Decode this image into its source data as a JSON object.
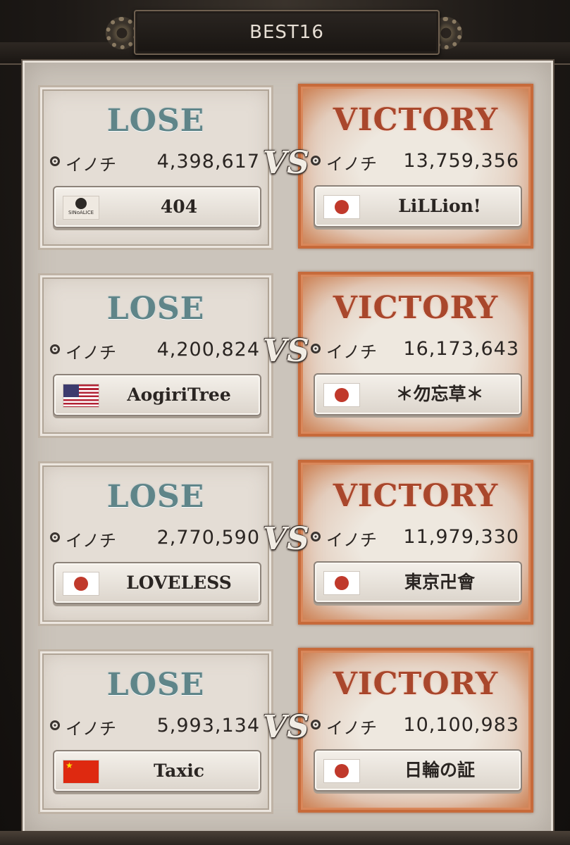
{
  "header": {
    "title": "BEST16"
  },
  "vs_label": "VS",
  "matches": [
    {
      "left": {
        "result": "LOSE",
        "life_label": "イノチ",
        "life": "4,398,617",
        "name": "404",
        "flag": "sinoalice",
        "flag_text": "SINoALICE"
      },
      "right": {
        "result": "VICTORY",
        "life_label": "イノチ",
        "life": "13,759,356",
        "name": "LiLLion!",
        "flag": "japan"
      }
    },
    {
      "left": {
        "result": "LOSE",
        "life_label": "イノチ",
        "life": "4,200,824",
        "name": "AogiriTree",
        "flag": "usa"
      },
      "right": {
        "result": "VICTORY",
        "life_label": "イノチ",
        "life": "16,173,643",
        "name": "＊勿忘草＊",
        "flag": "japan"
      }
    },
    {
      "left": {
        "result": "LOSE",
        "life_label": "イノチ",
        "life": "2,770,590",
        "name": "LOVELESS",
        "flag": "japan"
      },
      "right": {
        "result": "VICTORY",
        "life_label": "イノチ",
        "life": "11,979,330",
        "name": "東京卍會",
        "flag": "japan"
      }
    },
    {
      "left": {
        "result": "LOSE",
        "life_label": "イノチ",
        "life": "5,993,134",
        "name": "Taxic",
        "flag": "china"
      },
      "right": {
        "result": "VICTORY",
        "life_label": "イノチ",
        "life": "10,100,983",
        "name": "日輪の証",
        "flag": "japan"
      }
    }
  ]
}
